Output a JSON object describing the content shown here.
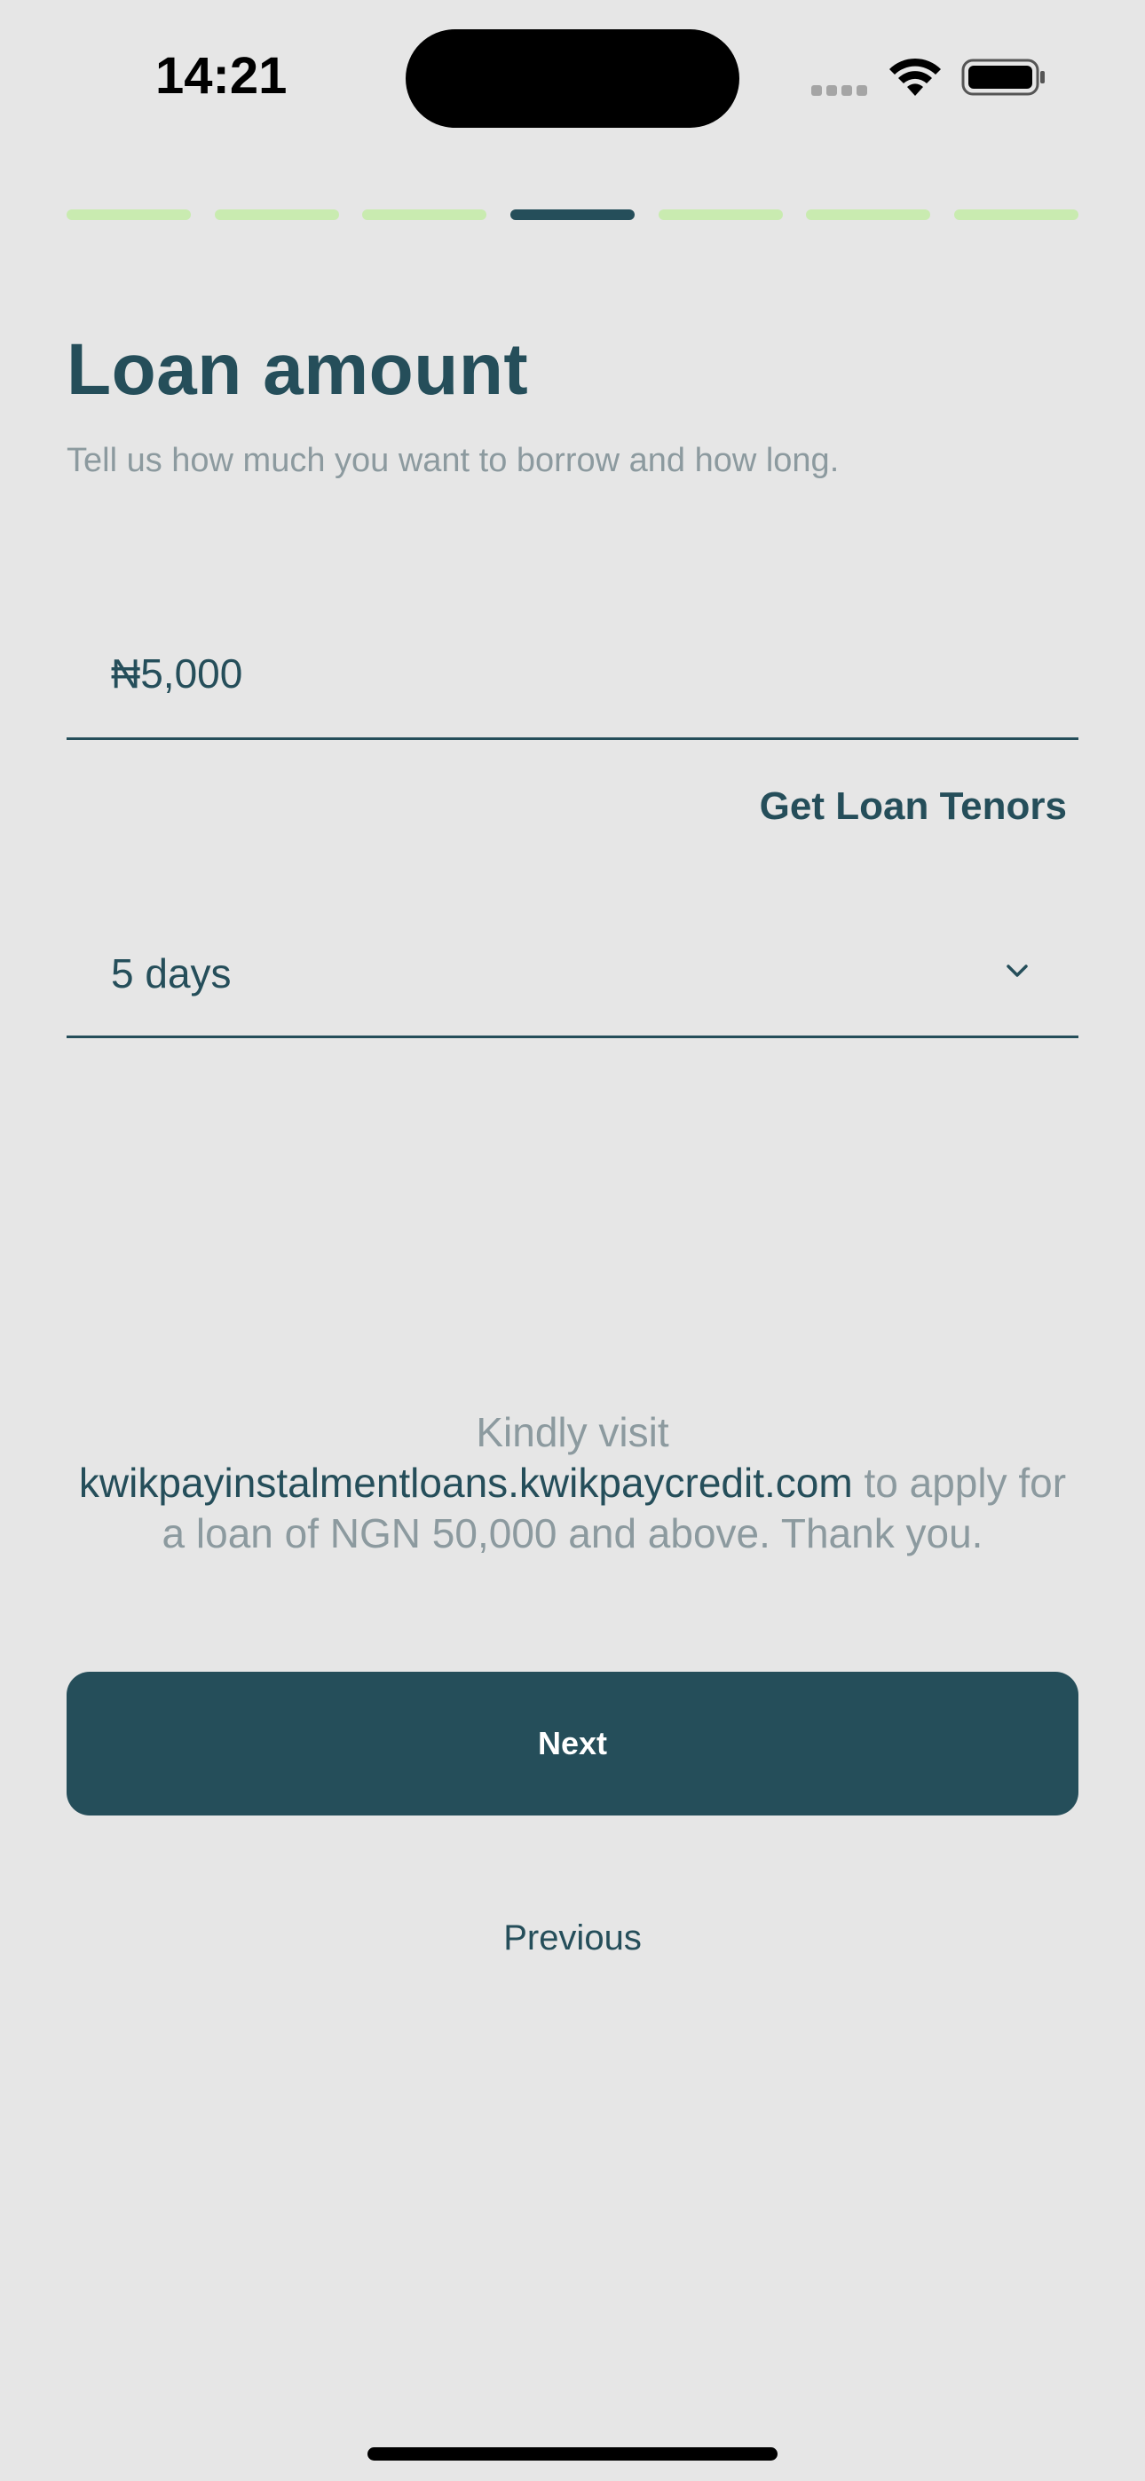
{
  "status_bar": {
    "time": "14:21"
  },
  "progress": {
    "total_steps": 7,
    "current_step": 4,
    "active_color": "#254e5a",
    "inactive_color": "#c9ebb0"
  },
  "page": {
    "title": "Loan amount",
    "subtitle": "Tell us how much you want to borrow and how long."
  },
  "form": {
    "amount_value": "₦5,000",
    "get_tenors_label": "Get Loan Tenors",
    "tenor_value": "5 days"
  },
  "notice": {
    "prefix": "Kindly visit",
    "link": "kwikpayinstalmentloans.kwikpaycredit.com",
    "suffix": "to apply for a loan of NGN 50,000 and above. Thank you."
  },
  "actions": {
    "next_label": "Next",
    "previous_label": "Previous"
  },
  "colors": {
    "primary": "#254e5a",
    "background": "#e6e6e6",
    "muted_text": "#8c9a9f"
  }
}
